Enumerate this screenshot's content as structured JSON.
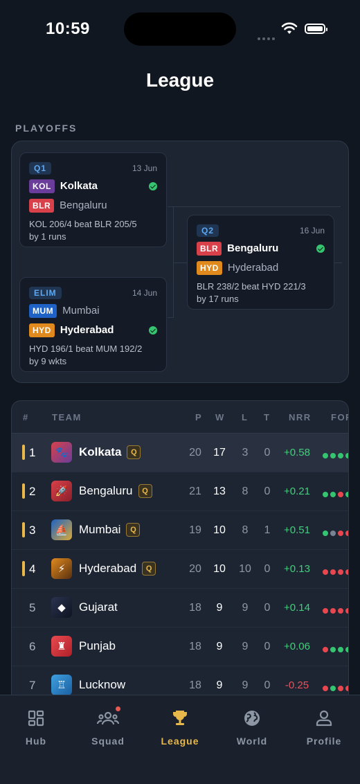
{
  "status_bar": {
    "time": "10:59"
  },
  "page": {
    "title": "League",
    "section_label": "PLAYOFFS"
  },
  "matches": [
    {
      "stage": "Q1",
      "date": "13 Jun",
      "teams": [
        {
          "abbr": "KOL",
          "name": "Kolkata",
          "color": "#6a3d9a",
          "winner": true
        },
        {
          "abbr": "BLR",
          "name": "Bengaluru",
          "color": "#d9414a",
          "winner": false
        }
      ],
      "result_line1": "KOL 206/4 beat BLR 205/5",
      "result_line2": "by 1 runs"
    },
    {
      "stage": "ELIM",
      "date": "14 Jun",
      "teams": [
        {
          "abbr": "MUM",
          "name": "Mumbai",
          "color": "#1d62c4",
          "winner": false
        },
        {
          "abbr": "HYD",
          "name": "Hyderabad",
          "color": "#e08a1e",
          "winner": true
        }
      ],
      "result_line1": "HYD 196/1 beat MUM 192/2",
      "result_line2": "by 9 wkts"
    },
    {
      "stage": "Q2",
      "date": "16 Jun",
      "teams": [
        {
          "abbr": "BLR",
          "name": "Bengaluru",
          "color": "#d9414a",
          "winner": true
        },
        {
          "abbr": "HYD",
          "name": "Hyderabad",
          "color": "#e08a1e",
          "winner": false
        }
      ],
      "result_line1": "BLR 238/2 beat HYD 221/3",
      "result_line2": "by 17 runs"
    }
  ],
  "table": {
    "headers": {
      "rank": "#",
      "team": "TEAM",
      "p": "P",
      "w": "W",
      "l": "L",
      "t": "T",
      "nrr": "NRR",
      "form": "FOF"
    },
    "qualified_badge": "Q",
    "rows": [
      {
        "rank": "1",
        "team": "Kolkata",
        "qualified": true,
        "p": "20",
        "w": "17",
        "l": "3",
        "t": "0",
        "nrr": "+0.58",
        "logo_icon": "paw-icon",
        "logo_glyph": "🐾",
        "form": [
          "W",
          "W",
          "W",
          "W",
          "W"
        ]
      },
      {
        "rank": "2",
        "team": "Bengaluru",
        "qualified": true,
        "p": "21",
        "w": "13",
        "l": "8",
        "t": "0",
        "nrr": "+0.21",
        "logo_icon": "rocket-icon",
        "logo_glyph": "🚀",
        "form": [
          "W",
          "W",
          "L",
          "W",
          "W"
        ]
      },
      {
        "rank": "3",
        "team": "Mumbai",
        "qualified": true,
        "p": "19",
        "w": "10",
        "l": "8",
        "t": "1",
        "nrr": "+0.51",
        "logo_icon": "ship-icon",
        "logo_glyph": "⛵",
        "form": [
          "W",
          "N",
          "L",
          "L",
          "W"
        ]
      },
      {
        "rank": "4",
        "team": "Hyderabad",
        "qualified": true,
        "p": "20",
        "w": "10",
        "l": "10",
        "t": "0",
        "nrr": "+0.13",
        "logo_icon": "bolt-icon",
        "logo_glyph": "⚡",
        "form": [
          "L",
          "L",
          "L",
          "L",
          "W"
        ]
      },
      {
        "rank": "5",
        "team": "Gujarat",
        "qualified": false,
        "p": "18",
        "w": "9",
        "l": "9",
        "t": "0",
        "nrr": "+0.14",
        "logo_icon": "diamond-icon",
        "logo_glyph": "◆",
        "form": [
          "L",
          "L",
          "L",
          "L",
          "W"
        ]
      },
      {
        "rank": "6",
        "team": "Punjab",
        "qualified": false,
        "p": "18",
        "w": "9",
        "l": "9",
        "t": "0",
        "nrr": "+0.06",
        "logo_icon": "trophy-icon",
        "logo_glyph": "♜",
        "form": [
          "L",
          "W",
          "W",
          "W",
          "W"
        ]
      },
      {
        "rank": "7",
        "team": "Lucknow",
        "qualified": false,
        "p": "18",
        "w": "9",
        "l": "9",
        "t": "0",
        "nrr": "-0.25",
        "logo_icon": "castle-icon",
        "logo_glyph": "♖",
        "form": [
          "L",
          "W",
          "L",
          "L",
          "W"
        ]
      }
    ]
  },
  "nav": [
    {
      "label": "Hub",
      "icon": "grid-icon",
      "active": false
    },
    {
      "label": "Squad",
      "icon": "team-icon",
      "active": false,
      "notification": true
    },
    {
      "label": "League",
      "icon": "trophy-icon",
      "active": true
    },
    {
      "label": "World",
      "icon": "globe-icon",
      "active": false
    },
    {
      "label": "Profile",
      "icon": "user-icon",
      "active": false
    }
  ],
  "colors": {
    "accent": "#e8b84a",
    "win": "#35c46f",
    "loss": "#e8474f",
    "no_result": "#7a8392",
    "positive": "#3fd07c",
    "negative": "#ef5059"
  }
}
